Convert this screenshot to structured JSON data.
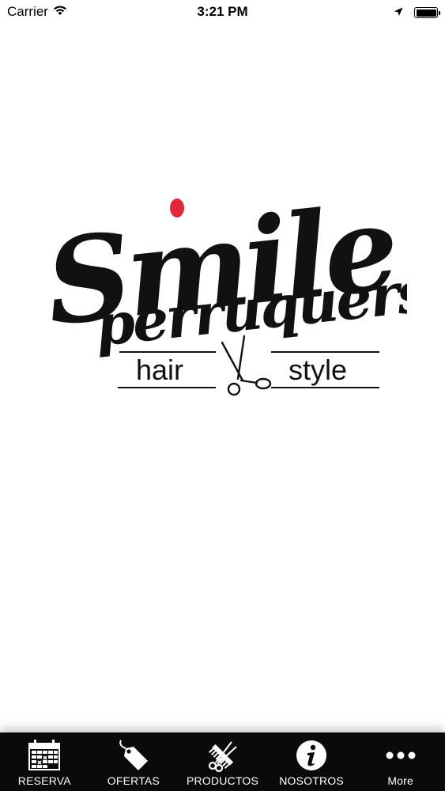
{
  "status_bar": {
    "carrier": "Carrier",
    "time": "3:21 PM",
    "battery_level": 1.0
  },
  "logo": {
    "line1": "Smile",
    "line2": "perruquers",
    "left_word": "hair",
    "right_word": "style",
    "accent_color": "#e0283a"
  },
  "tabs": [
    {
      "label": "RESERVA",
      "icon": "calendar-icon"
    },
    {
      "label": "OFERTAS",
      "icon": "tag-icon"
    },
    {
      "label": "PRODUCTOS",
      "icon": "comb-scissors-icon"
    },
    {
      "label": "NOSOTROS",
      "icon": "info-icon"
    },
    {
      "label": "More",
      "icon": "more-icon"
    }
  ],
  "colors": {
    "tab_bar_bg": "#0a0a0a",
    "tab_text": "#ffffff",
    "background": "#ffffff"
  }
}
